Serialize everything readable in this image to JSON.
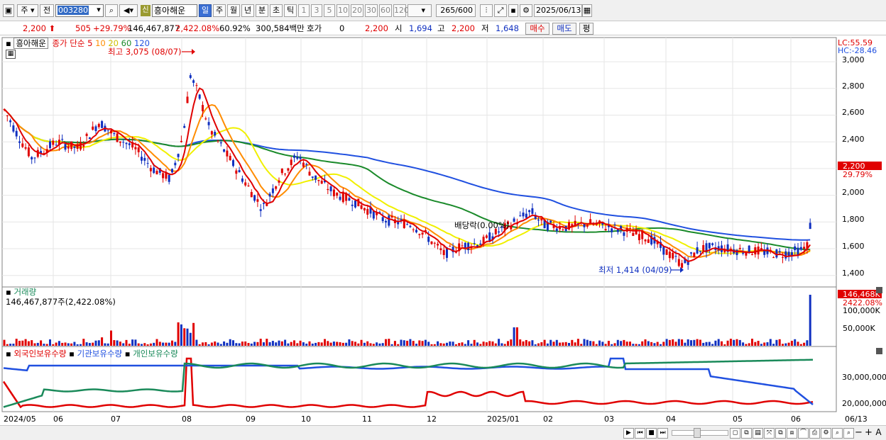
{
  "toolbar": {
    "period_type": "주",
    "market": "전",
    "code": "003280",
    "name": "흥아해운",
    "new_badge": "신",
    "intervals": [
      "일",
      "주",
      "월",
      "년",
      "분",
      "초",
      "틱"
    ],
    "active_interval": "일",
    "minutes": [
      "1",
      "3",
      "5",
      "10",
      "20",
      "30",
      "60",
      "120"
    ],
    "count": "265",
    "count_max": "/600",
    "date": "2025/06/13"
  },
  "quote": {
    "price": "2,200",
    "change": "505",
    "change_pct": "+29.79%",
    "volume": "146,467,877",
    "volume_ratio": "2,422.08%",
    "turnover_pct": "60.92%",
    "amount": "300,584백만",
    "hoga_label": "호가",
    "hoga_value": "0",
    "hoga_price": "2,200",
    "open_label": "시",
    "open": "1,694",
    "high_label": "고",
    "high": "2,200",
    "low_label": "저",
    "low": "1,648",
    "buy_button": "매수",
    "sell_button": "매도",
    "eval_button": "평"
  },
  "price_panel": {
    "name": "흥아해운",
    "ma_label": "종가 단순",
    "ma_periods": [
      "5",
      "10",
      "20",
      "60",
      "120"
    ],
    "ma_colors": [
      "#e00000",
      "#ff8c00",
      "#f0f000",
      "#1a8a2a",
      "#2050e0"
    ],
    "high_annotation": "최고 3,075 (08/07)",
    "low_annotation": "최저 1,414 (04/09)",
    "dividend_annotation": "배당락(0.00%)",
    "lc_label": "LC:55.59",
    "hc_label": "HC:-28.46",
    "y_ticks": [
      "3,000",
      "2,800",
      "2,600",
      "2,400",
      "2,200",
      "2,000",
      "1,800",
      "1,600",
      "1,400"
    ],
    "last_price_tag": "2,200",
    "last_change_tag": "29.79%"
  },
  "volume_panel": {
    "title": "거래량",
    "value": "146,467,877주(2,422.08%)",
    "tag_value": "146,468K",
    "tag_pct": "2422.08%",
    "y_ticks": [
      "100,000K",
      "50,000K"
    ]
  },
  "holding_panel": {
    "series": [
      "외국인보유수량",
      "기관보유수량",
      "개인보유수량"
    ],
    "colors": [
      "#e00000",
      "#2050e0",
      "#1a8a5a"
    ],
    "y_ticks": [
      "30,000,000",
      "20,000,000"
    ]
  },
  "x_axis": {
    "labels": [
      "2024/05",
      "06",
      "07",
      "08",
      "09",
      "10",
      "11",
      "12",
      "2025/01",
      "02",
      "03",
      "04",
      "05",
      "06",
      "06/13"
    ]
  }
}
